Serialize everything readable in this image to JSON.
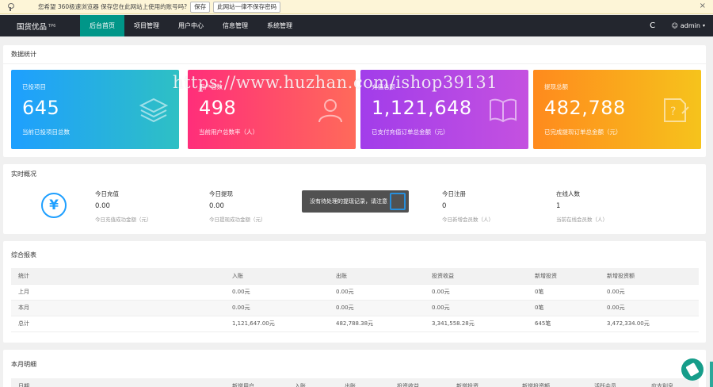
{
  "pwbar": {
    "message": "您希望 360极速浏览器 保存您在此网站上使用的账号吗?",
    "save": "保存",
    "never": "此网站一律不保存密码",
    "close": "×"
  },
  "nav": {
    "brand": "国货优品",
    "brand_sup": "TP6",
    "items": [
      "后台首页",
      "项目管理",
      "用户中心",
      "信息管理",
      "系统管理"
    ],
    "refresh": "C",
    "user": "admin"
  },
  "stats": {
    "title": "数据统计",
    "cards": [
      {
        "title": "已投项目",
        "value": "645",
        "desc": "当前已投项目总数",
        "color_from": "#1e9fff",
        "color_to": "#2ec0c4",
        "icon": "layers-icon"
      },
      {
        "title": "用户总数",
        "value": "498",
        "desc": "当前用户总数率（人）",
        "color_from": "#ff2e7a",
        "color_to": "#ff6a5a",
        "icon": "user-icon"
      },
      {
        "title": "充值总额",
        "value": "1,121,648",
        "desc": "已支付充值订单总金额（元）",
        "color_from": "#a23dea",
        "color_to": "#c451e0",
        "icon": "book-icon"
      },
      {
        "title": "提现总额",
        "value": "482,788",
        "desc": "已完成提现订单总金额（元）",
        "color_from": "#ff8a1d",
        "color_to": "#f6c31c",
        "icon": "help-icon"
      }
    ]
  },
  "realtime": {
    "title": "实时概况",
    "icon": "yen-icon",
    "cols": [
      {
        "label": "今日充值",
        "value": "0.00",
        "desc": "今日充值成功金额（元）"
      },
      {
        "label": "今日提现",
        "value": "0.00",
        "desc": "今日提现成功金额（元）"
      },
      {
        "label": "今日注册",
        "value": "0",
        "desc": "今日新增会员数（人）"
      },
      {
        "label": "在线人数",
        "value": "1",
        "desc": "当前在线会员数（人）"
      }
    ]
  },
  "toast": {
    "text": "没有待处理的提现记录，请注意"
  },
  "watermark": "https://www.huzhan.com/ishop39131",
  "summary": {
    "title": "综合报表",
    "headers": [
      "统计",
      "入账",
      "出账",
      "投资收益",
      "新增投资",
      "新增投资额"
    ],
    "rows": [
      [
        "上月",
        "0.00元",
        "0.00元",
        "0.00元",
        "0笔",
        "0.00元"
      ],
      [
        "本月",
        "0.00元",
        "0.00元",
        "0.00元",
        "0笔",
        "0.00元"
      ],
      [
        "总计",
        "1,121,647.00元",
        "482,788.38元",
        "3,341,558.28元",
        "645笔",
        "3,472,334.00元"
      ]
    ]
  },
  "monthly": {
    "title": "本月明细",
    "headers": [
      "日期",
      "新增用户",
      "入账",
      "出账",
      "投资收益",
      "新增投资",
      "新增投资额",
      "活跃会员",
      "应支利息"
    ]
  }
}
